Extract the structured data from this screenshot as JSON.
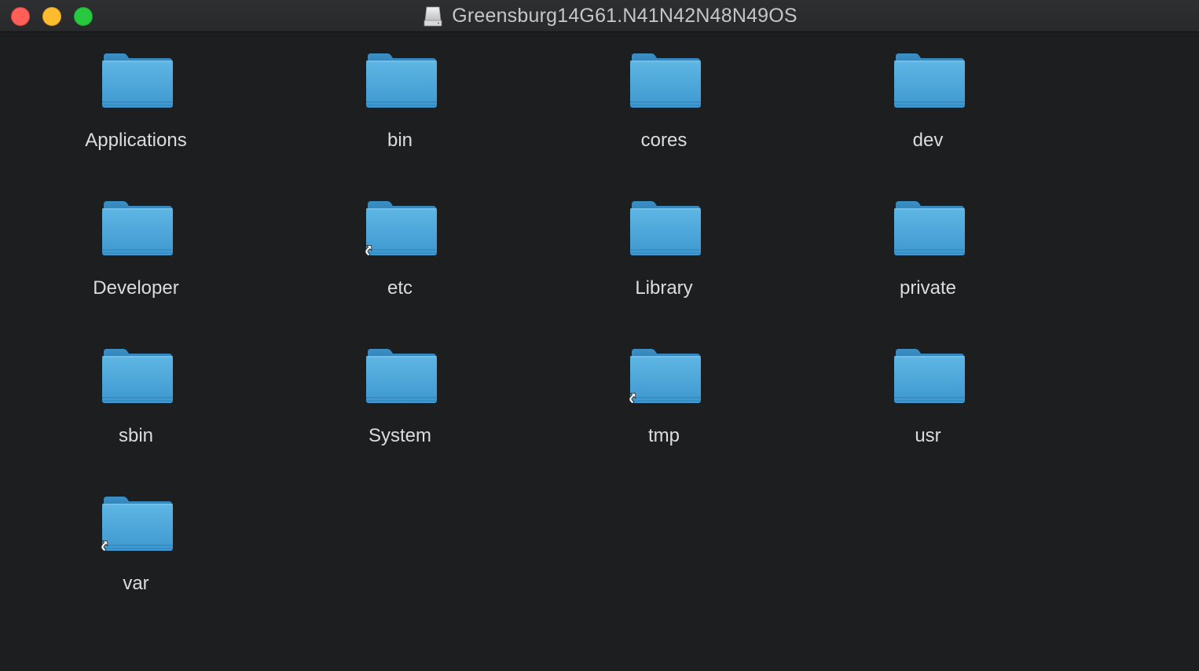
{
  "window": {
    "title": "Greensburg14G61.N41N42N48N49OS",
    "title_icon": "internal-drive-icon",
    "buttons": {
      "close": "close-button",
      "minimize": "minimize-button",
      "zoom": "zoom-button"
    }
  },
  "colors": {
    "background": "#1d1e20",
    "folder_blue": "#4aa3d6",
    "close": "#fe5f57",
    "minimize": "#febc2e",
    "zoom": "#28c840"
  },
  "items": [
    {
      "label": "Applications",
      "icon": "folder-icon",
      "alias": false
    },
    {
      "label": "bin",
      "icon": "folder-icon",
      "alias": false
    },
    {
      "label": "cores",
      "icon": "folder-icon",
      "alias": false
    },
    {
      "label": "dev",
      "icon": "folder-icon",
      "alias": false
    },
    {
      "label": "Developer",
      "icon": "folder-icon",
      "alias": false
    },
    {
      "label": "etc",
      "icon": "folder-icon",
      "alias": true
    },
    {
      "label": "Library",
      "icon": "folder-icon",
      "alias": false
    },
    {
      "label": "private",
      "icon": "folder-icon",
      "alias": false
    },
    {
      "label": "sbin",
      "icon": "folder-icon",
      "alias": false
    },
    {
      "label": "System",
      "icon": "folder-icon",
      "alias": false
    },
    {
      "label": "tmp",
      "icon": "folder-icon",
      "alias": true
    },
    {
      "label": "usr",
      "icon": "folder-icon",
      "alias": false
    },
    {
      "label": "var",
      "icon": "folder-icon",
      "alias": true
    }
  ]
}
